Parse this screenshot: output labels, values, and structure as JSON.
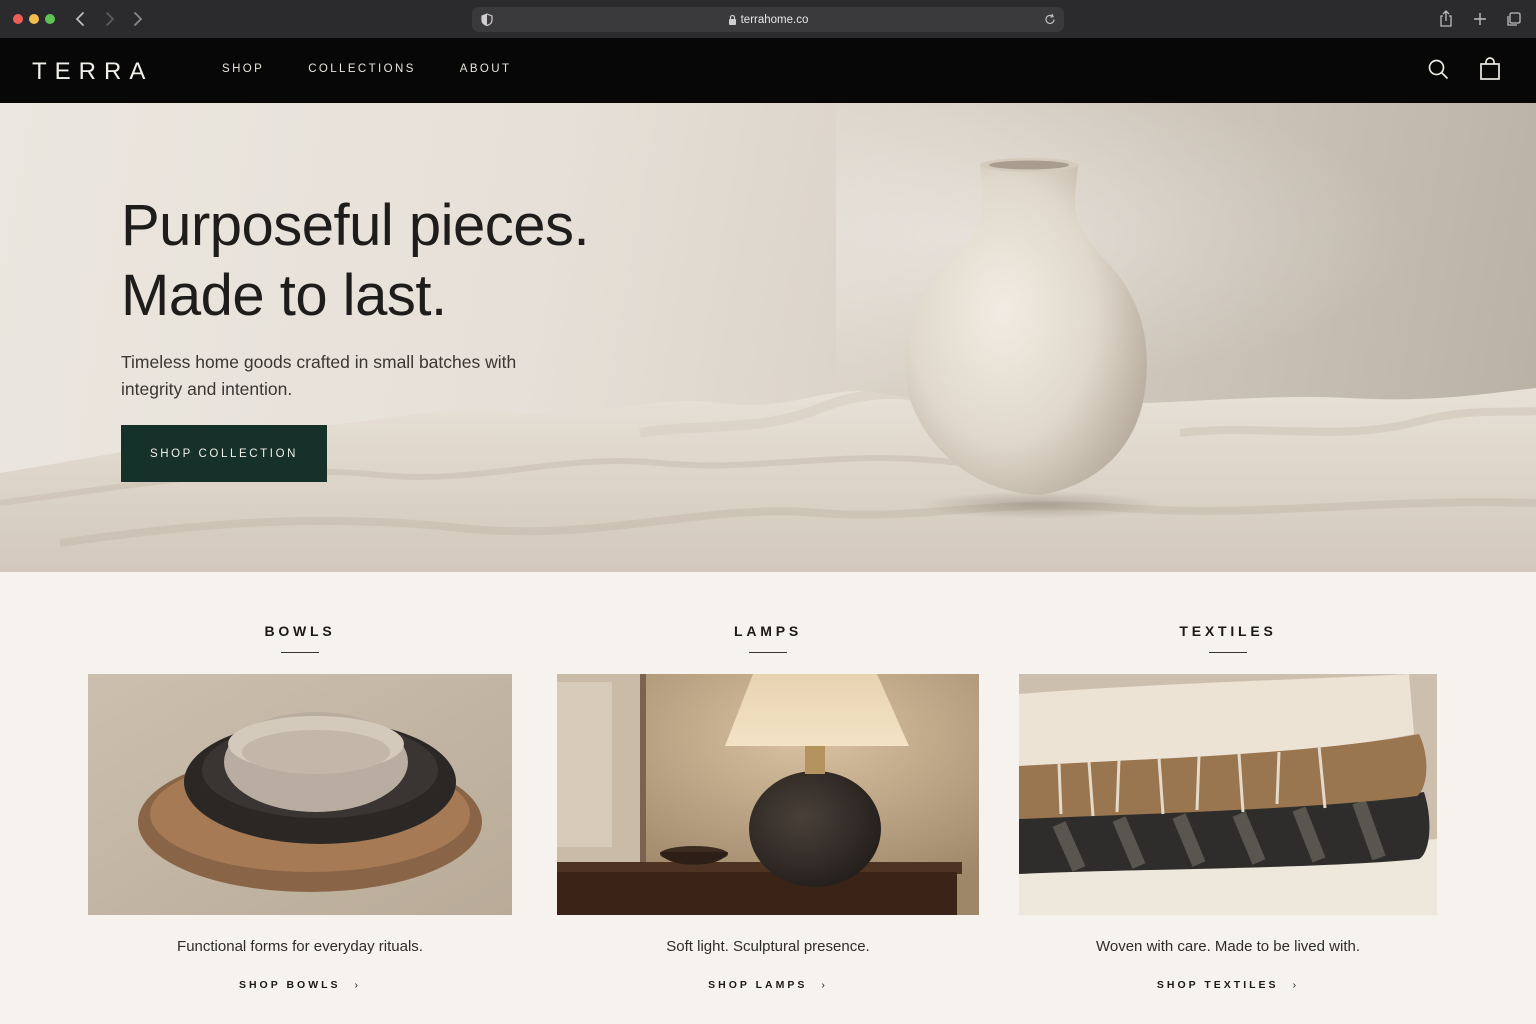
{
  "browser": {
    "url": "terrahome.co",
    "icons": [
      "back-icon",
      "forward-icon",
      "shield-icon",
      "lock-icon",
      "reload-icon",
      "share-icon",
      "new-tab-icon",
      "tabs-icon"
    ]
  },
  "header": {
    "logo": "TERRA",
    "nav": [
      "SHOP",
      "COLLECTIONS",
      "ABOUT"
    ],
    "icons": [
      "search-icon",
      "bag-icon"
    ]
  },
  "hero": {
    "title_line1": "Purposeful pieces.",
    "title_line2": "Made to last.",
    "subtitle": "Timeless home goods crafted in small batches with integrity and intention.",
    "cta": "SHOP COLLECTION"
  },
  "categories": [
    {
      "title": "BOWLS",
      "description": "Functional forms for everyday rituals.",
      "link": "SHOP BOWLS"
    },
    {
      "title": "LAMPS",
      "description": "Soft light. Sculptural presence.",
      "link": "SHOP LAMPS"
    },
    {
      "title": "TEXTILES",
      "description": "Woven with care. Made to be lived with.",
      "link": "SHOP TEXTILES"
    }
  ],
  "colors": {
    "header_bg": "#070707",
    "cta_bg": "#163129",
    "page_bg": "#f6f2ed"
  }
}
